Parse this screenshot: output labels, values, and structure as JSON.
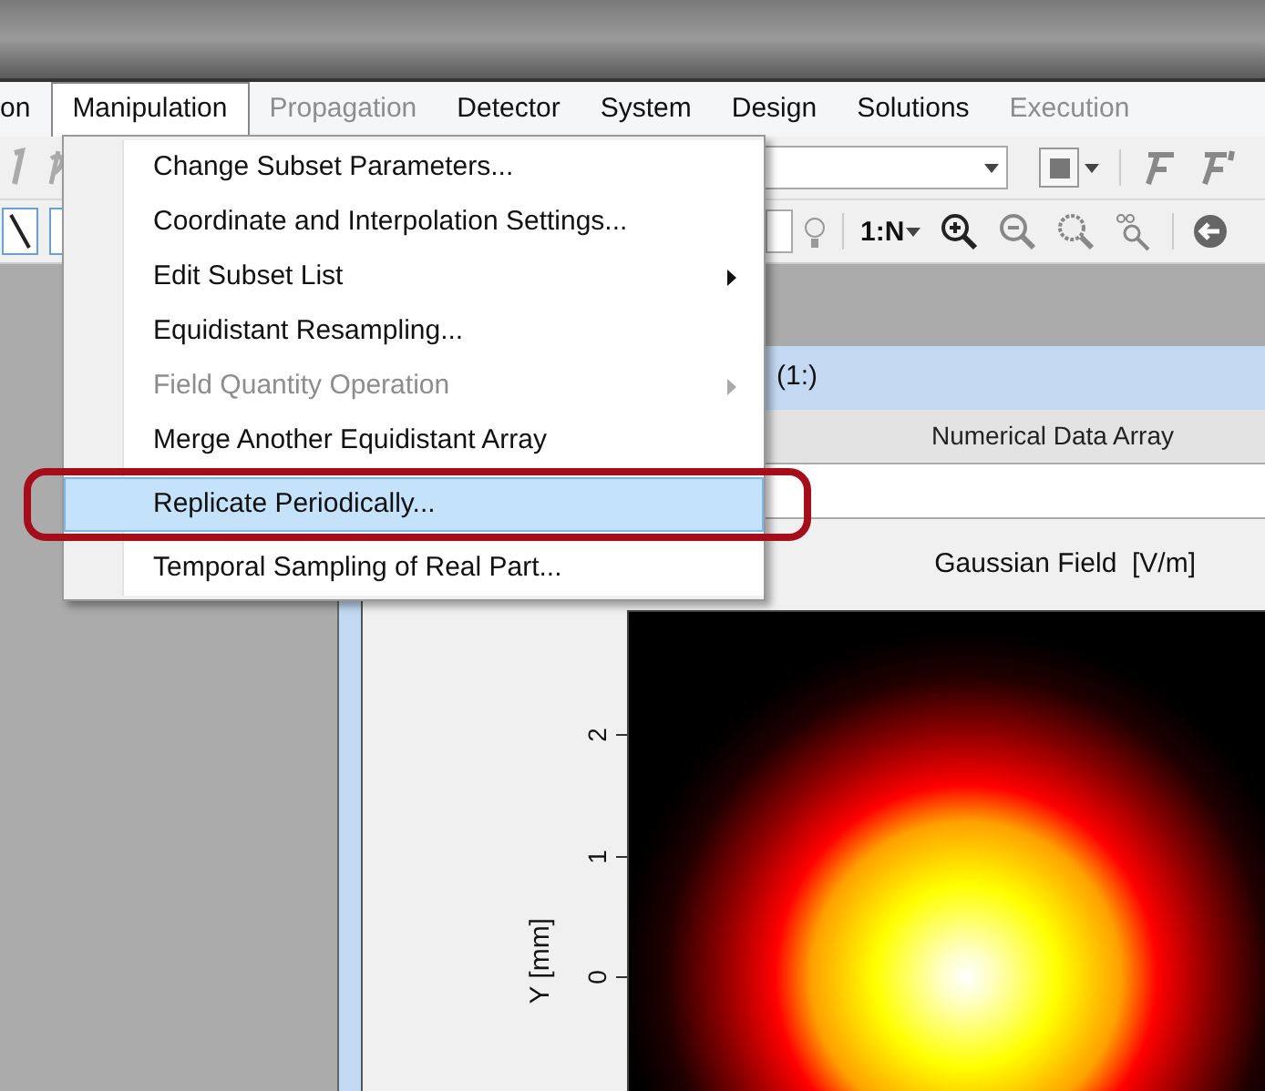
{
  "menu_bar": [
    {
      "label": "on",
      "selected": false,
      "disabled": false
    },
    {
      "label": "Manipulation",
      "selected": true,
      "disabled": false
    },
    {
      "label": "Propagation",
      "selected": false,
      "disabled": true
    },
    {
      "label": "Detector",
      "selected": false,
      "disabled": false
    },
    {
      "label": "System",
      "selected": false,
      "disabled": false
    },
    {
      "label": "Design",
      "selected": false,
      "disabled": false
    },
    {
      "label": "Solutions",
      "selected": false,
      "disabled": false
    },
    {
      "label": "Execution",
      "selected": false,
      "disabled": true
    }
  ],
  "toolbar": {
    "ratio_button": "1:N"
  },
  "dropdown_menu": [
    {
      "label": "Change Subset Parameters...",
      "disabled": false,
      "selected": false,
      "submenu": false
    },
    {
      "label": "Coordinate and Interpolation Settings...",
      "disabled": false,
      "selected": false,
      "submenu": false
    },
    {
      "label": "Edit Subset List",
      "disabled": false,
      "selected": false,
      "submenu": true
    },
    {
      "label": "Equidistant Resampling...",
      "disabled": false,
      "selected": false,
      "submenu": false
    },
    {
      "label": "Field Quantity Operation",
      "disabled": true,
      "selected": false,
      "submenu": true
    },
    {
      "label": "Merge Another Equidistant Array",
      "disabled": false,
      "selected": false,
      "submenu": false
    },
    {
      "label": "Replicate Periodically...",
      "disabled": false,
      "selected": true,
      "submenu": false
    },
    {
      "label": "Temporal Sampling of Real Part...",
      "disabled": false,
      "selected": false,
      "submenu": false
    }
  ],
  "document_window": {
    "title": "(1:)",
    "tab": "Numerical Data Array",
    "plot": {
      "title": "Gaussian Field  [V/m]",
      "y_label": "Y [mm]",
      "y_ticks": [
        "2",
        "1",
        "0"
      ]
    }
  }
}
